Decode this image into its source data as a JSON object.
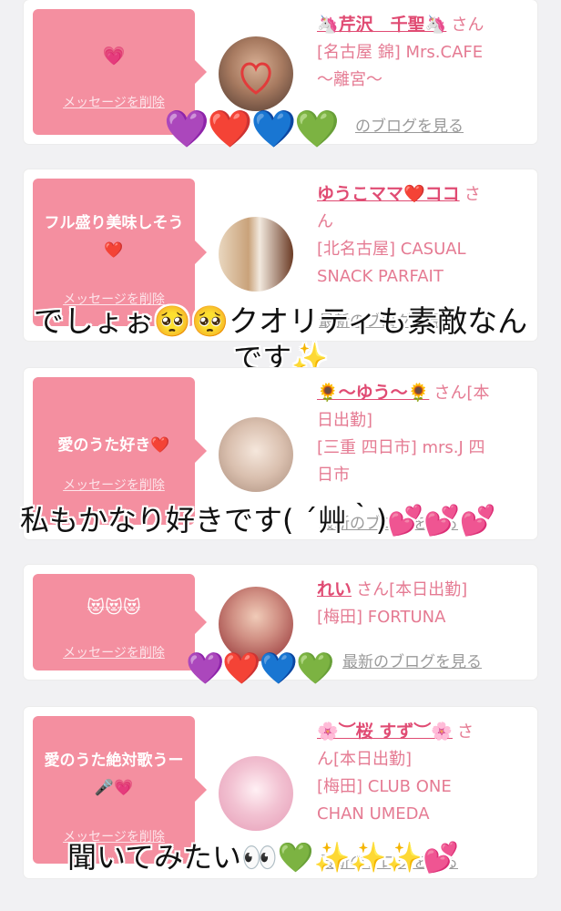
{
  "cards": [
    {
      "message": "💗",
      "delete_label": "メッセージを削除",
      "name": "🦄芹沢　千聖🦄",
      "san": "さん",
      "lines": [
        "[名古屋 錦] Mrs.CAFE",
        "〜離宮〜"
      ],
      "blog_label": "のブログを見る",
      "avatar_colors": [
        "#c99b7d",
        "#5a3f33"
      ]
    },
    {
      "message": "フル盛り美味しそう❤️",
      "delete_label": "メッセージを削除",
      "name": "ゆうこママ❤️ココ",
      "san": "さ",
      "lines": [
        "ん",
        "[北名古屋] CASUAL",
        "SNACK PARFAIT"
      ],
      "blog_label": "最新のブログを見る",
      "avatar_colors": [
        "#e8d3b8",
        "#8a5a3a"
      ]
    },
    {
      "message": "愛のうた好き❤️",
      "delete_label": "メッセージを削除",
      "name": "🌻〜ゆう〜🌻",
      "san": "さん[本",
      "lines": [
        "日出勤]",
        "[三重 四日市] mrs.J 四",
        "日市"
      ],
      "blog_label": "最新のブログを見る",
      "avatar_colors": [
        "#f0dfd3",
        "#b99a88"
      ]
    },
    {
      "message": "😻😻😻",
      "delete_label": "メッセージを削除",
      "name": "れい",
      "san": "さん[本日出勤]",
      "lines": [
        "[梅田] FORTUNA"
      ],
      "blog_label": "最新のブログを見る",
      "avatar_colors": [
        "#e7b8a5",
        "#9d2b2f"
      ]
    },
    {
      "message": "愛のうた絶対歌うー🎤💗",
      "delete_label": "メッセージを削除",
      "name": "🌸︶桜 すず︶🌸",
      "san": "さ",
      "lines": [
        "ん[本日出勤]",
        "[梅田] CLUB ONE",
        "CHAN UMEDA"
      ],
      "blog_label": "最新のブログを見る",
      "avatar_colors": [
        "#f7d4df",
        "#e79ab4"
      ]
    }
  ],
  "overlays": {
    "line1": "でしょぉ🥺🥺クオリティも素敵なん",
    "line2": "です✨",
    "line3": "私もかなり好きです( ´艸｀)💕💕💕",
    "line4": "聞いてみたい👀💚✨✨✨💕",
    "hearts_top": "💜❤️💙💚",
    "hearts_mid": "💜❤️💙💚"
  }
}
